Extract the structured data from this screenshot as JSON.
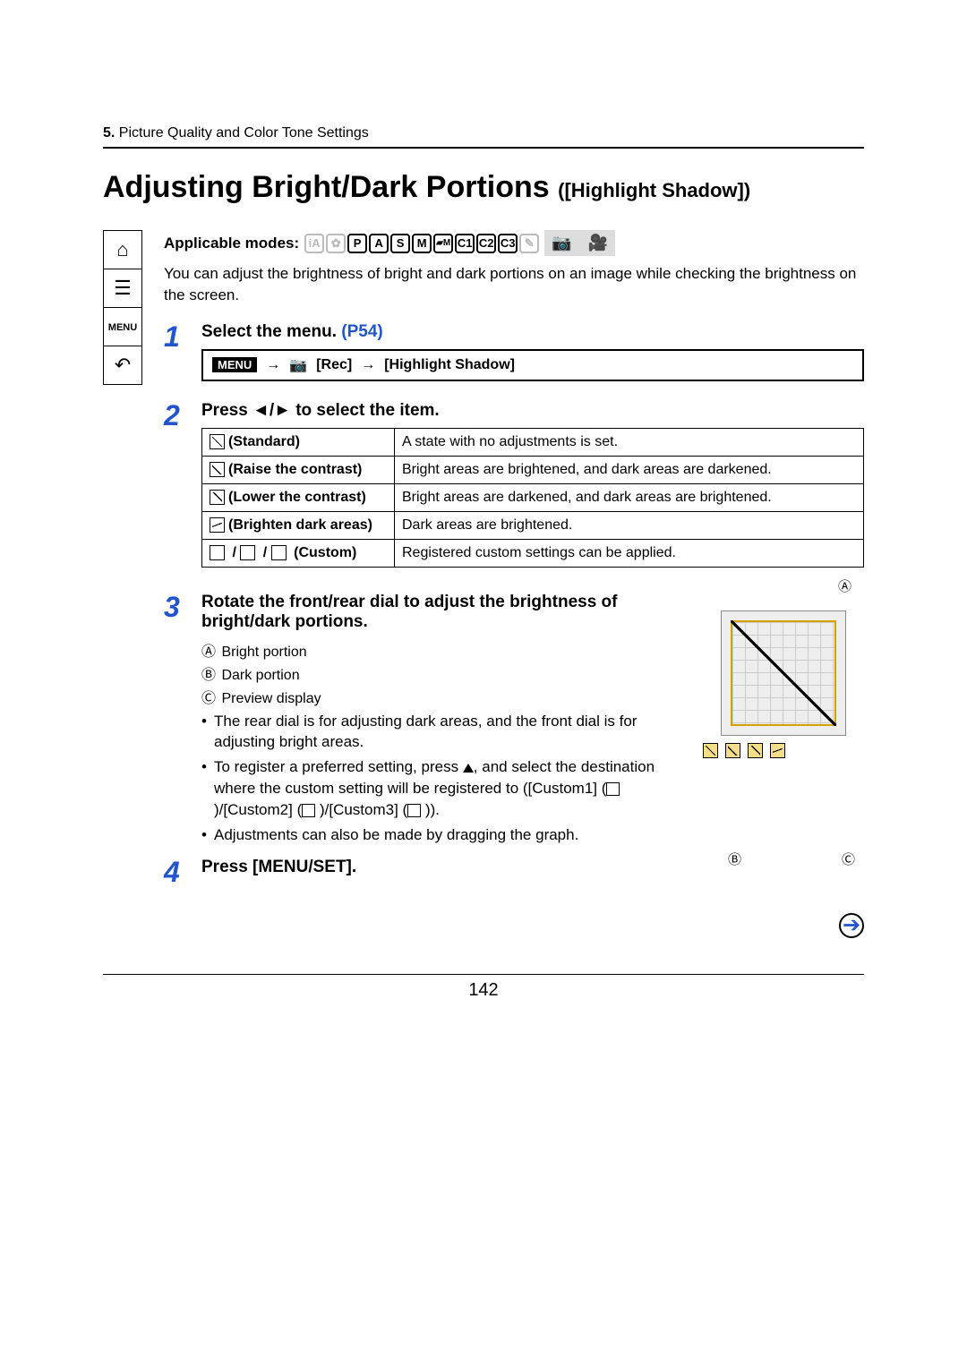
{
  "breadcrumb": {
    "num": "5.",
    "text": "Picture Quality and Color Tone Settings"
  },
  "title": "Adjusting Bright/Dark Portions",
  "subtitle": "([Highlight Shadow])",
  "applicable_label": "Applicable modes:",
  "modes": [
    "P",
    "A",
    "S",
    "M",
    "",
    "C1",
    "C2",
    "C3"
  ],
  "intro": "You can adjust the brightness of bright and dark portions on an image while checking the brightness on the screen.",
  "nav": {
    "menu_label": "MENU"
  },
  "steps": {
    "s1": {
      "num": "1",
      "title": "Select the menu.",
      "ref": "(P54)",
      "menu_tag": "MENU",
      "path1": "[Rec]",
      "path2": "[Highlight Shadow]"
    },
    "s2": {
      "num": "2",
      "title": "Press ◄/► to select the item."
    },
    "s3": {
      "num": "3",
      "title": "Rotate the front/rear dial to adjust the brightness of bright/dark portions.",
      "callout_A": "Bright portion",
      "callout_B": "Dark portion",
      "callout_C": "Preview display",
      "bullet1": "The rear dial is for adjusting dark areas, and the front dial is for adjusting bright areas.",
      "bullet2a": "To register a preferred setting, press ",
      "bullet2b": ", and select the destination where the custom setting will be registered to ([Custom1] (",
      "bullet2c": " )/[Custom2] (",
      "bullet2d": " )/[Custom3] (",
      "bullet2e": " )).",
      "bullet3": "Adjustments can also be made by dragging the graph."
    },
    "s4": {
      "num": "4",
      "title": "Press [MENU/SET]."
    }
  },
  "table": {
    "r1": {
      "name": "(Standard)",
      "desc": "A state with no adjustments is set."
    },
    "r2": {
      "name": "(Raise the contrast)",
      "desc": "Bright areas are brightened, and dark areas are darkened."
    },
    "r3": {
      "name": "(Lower the contrast)",
      "desc": "Bright areas are darkened, and dark areas are brightened."
    },
    "r4": {
      "name": "(Brighten dark areas)",
      "desc": "Dark areas are brightened."
    },
    "r5": {
      "name": "(Custom)",
      "desc": "Registered custom settings can be applied."
    }
  },
  "letters": {
    "A": "Ⓐ",
    "B": "Ⓑ",
    "C": "Ⓒ"
  },
  "page_number": "142"
}
